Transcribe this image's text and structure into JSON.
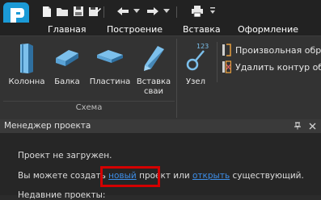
{
  "titlebar": {
    "quick_access": [
      "new-file-icon",
      "open-folder-icon",
      "save-icon",
      "save-as-icon",
      "undo-icon",
      "redo-icon",
      "print-icon"
    ]
  },
  "tabs": [
    "Главная",
    "Построение",
    "Вставка",
    "Оформление"
  ],
  "ribbon": {
    "scheme_group": {
      "label": "Схема",
      "buttons": [
        {
          "label": "Колонна",
          "icon": "column-icon"
        },
        {
          "label": "Балка",
          "icon": "beam-icon"
        },
        {
          "label": "Пластина",
          "icon": "plate-icon"
        },
        {
          "label_line1": "Вставка",
          "label_line2": "сваи",
          "icon": "pile-icon"
        }
      ]
    },
    "node_group": {
      "node_button": {
        "label": "Узел",
        "icon": "node-icon",
        "badge": "123"
      },
      "custom_button": {
        "label": "Произвольная обре",
        "icon": "custom-trim-icon"
      },
      "remove_contour_button": {
        "label": "Удалить контур обр",
        "icon": "remove-contour-icon"
      }
    }
  },
  "panel": {
    "title": "Менеджер проекта",
    "pin_symbol": "ᵖ",
    "close_symbol": "✕",
    "message_not_loaded": "Проект не загружен.",
    "message_prefix": "Вы можете создать",
    "link_new": "новый",
    "message_mid": "проект или",
    "link_open": "открыть",
    "message_suffix": "существующий.",
    "recent_label": "Недавние проекты:"
  },
  "colors": {
    "accent": "#1b9ad6",
    "link": "#3d8ee8",
    "highlight": "#d40000"
  }
}
